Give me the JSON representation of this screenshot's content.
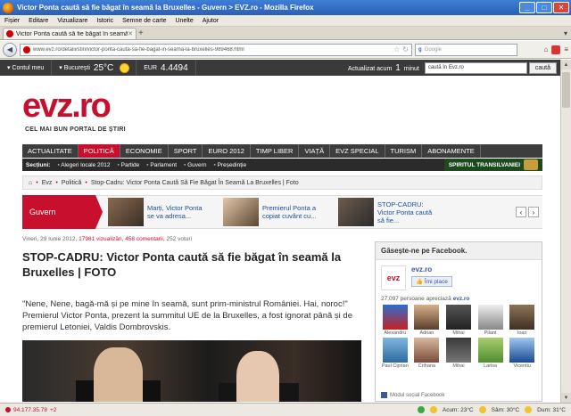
{
  "window": {
    "title": "Victor Ponta caută să fie băgat în seamă la Bruxelles - Guvern > EVZ.ro - Mozilla Firefox"
  },
  "menu": [
    "Fișier",
    "Editare",
    "Vizualizare",
    "Istoric",
    "Semne de carte",
    "Unelte",
    "Ajutor"
  ],
  "tab": {
    "label": "Victor Ponta caută să fie băgat în seamă la B..."
  },
  "nav": {
    "url": "www.evz.ro/detalii/stiri/victor-ponta-cauta-sa-fie-bagat-in-seama-la-bruxelles-989468.html",
    "search_placeholder": "Google"
  },
  "sitebar": {
    "account": "Contul meu",
    "city": "București",
    "temp": "25°C",
    "eur_label": "EUR",
    "eur_value": "4.4494",
    "updated_prefix": "Actualizat acum",
    "updated_num": "1",
    "updated_unit": "minut",
    "search_value": "caută în Evz.ro",
    "search_button": "caută"
  },
  "brand": {
    "logo": "evz.ro",
    "tagline": "CEL MAI BUN PORTAL DE ȘTIRI"
  },
  "categories": [
    "ACTUALITATE",
    "POLITICĂ",
    "ECONOMIE",
    "SPORT",
    "EURO 2012",
    "TIMP LIBER",
    "VIAȚĂ",
    "EVZ SPECIAL",
    "TURISM",
    "ABONAMENTE"
  ],
  "subnav": {
    "label": "Secțiuni:",
    "items": [
      "Alegeri locale 2012",
      "Partide",
      "Parlament",
      "Guvern",
      "Președinție"
    ],
    "promo": "SPIRITUL TRANSILVANIEI"
  },
  "breadcrumb": [
    "Evz",
    "Politică",
    "Stop-Cadru: Victor Ponta Caută Să Fie Băgat În Seamă La Bruxelles | Foto"
  ],
  "guvern": {
    "title": "Guvern",
    "items": [
      "Marți, Victor Ponta se va adresa...",
      "Premierul Ponta a copiat cuvânt cu...",
      "STOP-CADRU: Victor Ponta caută să fie..."
    ]
  },
  "article": {
    "date": "Vineri, 29 Iunie 2012,",
    "views": "17981 vizualizări,",
    "comments": "458 comentarii,",
    "votes": "252 voturi",
    "title": "STOP-CADRU: Victor Ponta caută să fie băgat în seamă la Bruxelles | FOTO",
    "lead": "\"Nene, Nene, bagă-mă și pe mine în seamă, sunt prim-ministrul României. Hai, noroc!\" Premierul Victor Ponta, prezent la summitul UE de la Bruxelles, a fost ignorat până și de premierul Letoniei, Valdis Dombrovskis."
  },
  "facebook": {
    "header": "Găsește-ne pe Facebook.",
    "page_name": "evz.ro",
    "like_label": "Îmi place",
    "count_text": "27,097 persoane apreciază",
    "count_page": "evz.ro",
    "people": [
      "Alexandru",
      "Adrian",
      "Mihai",
      "Pilant",
      "Ioan",
      "Paul Ciprian",
      "Crihana",
      "Mihai",
      "Larisa",
      "Vicentiu"
    ],
    "footer": "Modul social Facebook"
  },
  "status": {
    "ip": "94.177.35.78",
    "ip_suffix": "+2",
    "weather1": "Acum: 23°C",
    "weather2": "Sâm: 30°C",
    "weather3": "Dum: 31°C"
  }
}
